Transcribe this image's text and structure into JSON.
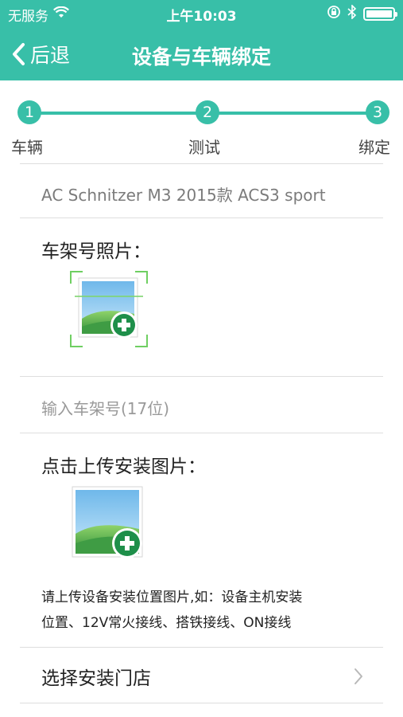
{
  "status_bar": {
    "carrier": "无服务",
    "time": "上午10:03"
  },
  "nav": {
    "back_label": "后退",
    "title": "设备与车辆绑定"
  },
  "stepper": {
    "steps": [
      {
        "number": "1",
        "label": "车辆"
      },
      {
        "number": "2",
        "label": "测试"
      },
      {
        "number": "3",
        "label": "绑定"
      }
    ]
  },
  "vehicle": {
    "name": "AC Schnitzer M3 2015款 ACS3 sport"
  },
  "vin_photo": {
    "title": "车架号照片："
  },
  "vin_input": {
    "placeholder": "输入车架号(17位)",
    "value": ""
  },
  "install_photo": {
    "title": "点击上传安装图片：",
    "hint_line1": "请上传设备安装位置图片,如：设备主机安装",
    "hint_line2": "位置、12V常火接线、搭铁接线、ON接线"
  },
  "store": {
    "label": "选择安装门店"
  },
  "colors": {
    "primary": "#38bfa8",
    "scan_corner": "#6fcf62",
    "plus_badge": "#1e8f4a"
  },
  "icons": {
    "wifi": "wifi-icon",
    "lock_rotation": "orientation-lock-icon",
    "bluetooth": "bluetooth-icon",
    "battery": "battery-icon",
    "back": "chevron-left-icon",
    "add_image": "add-image-icon",
    "chevron_right": "chevron-right-icon"
  }
}
